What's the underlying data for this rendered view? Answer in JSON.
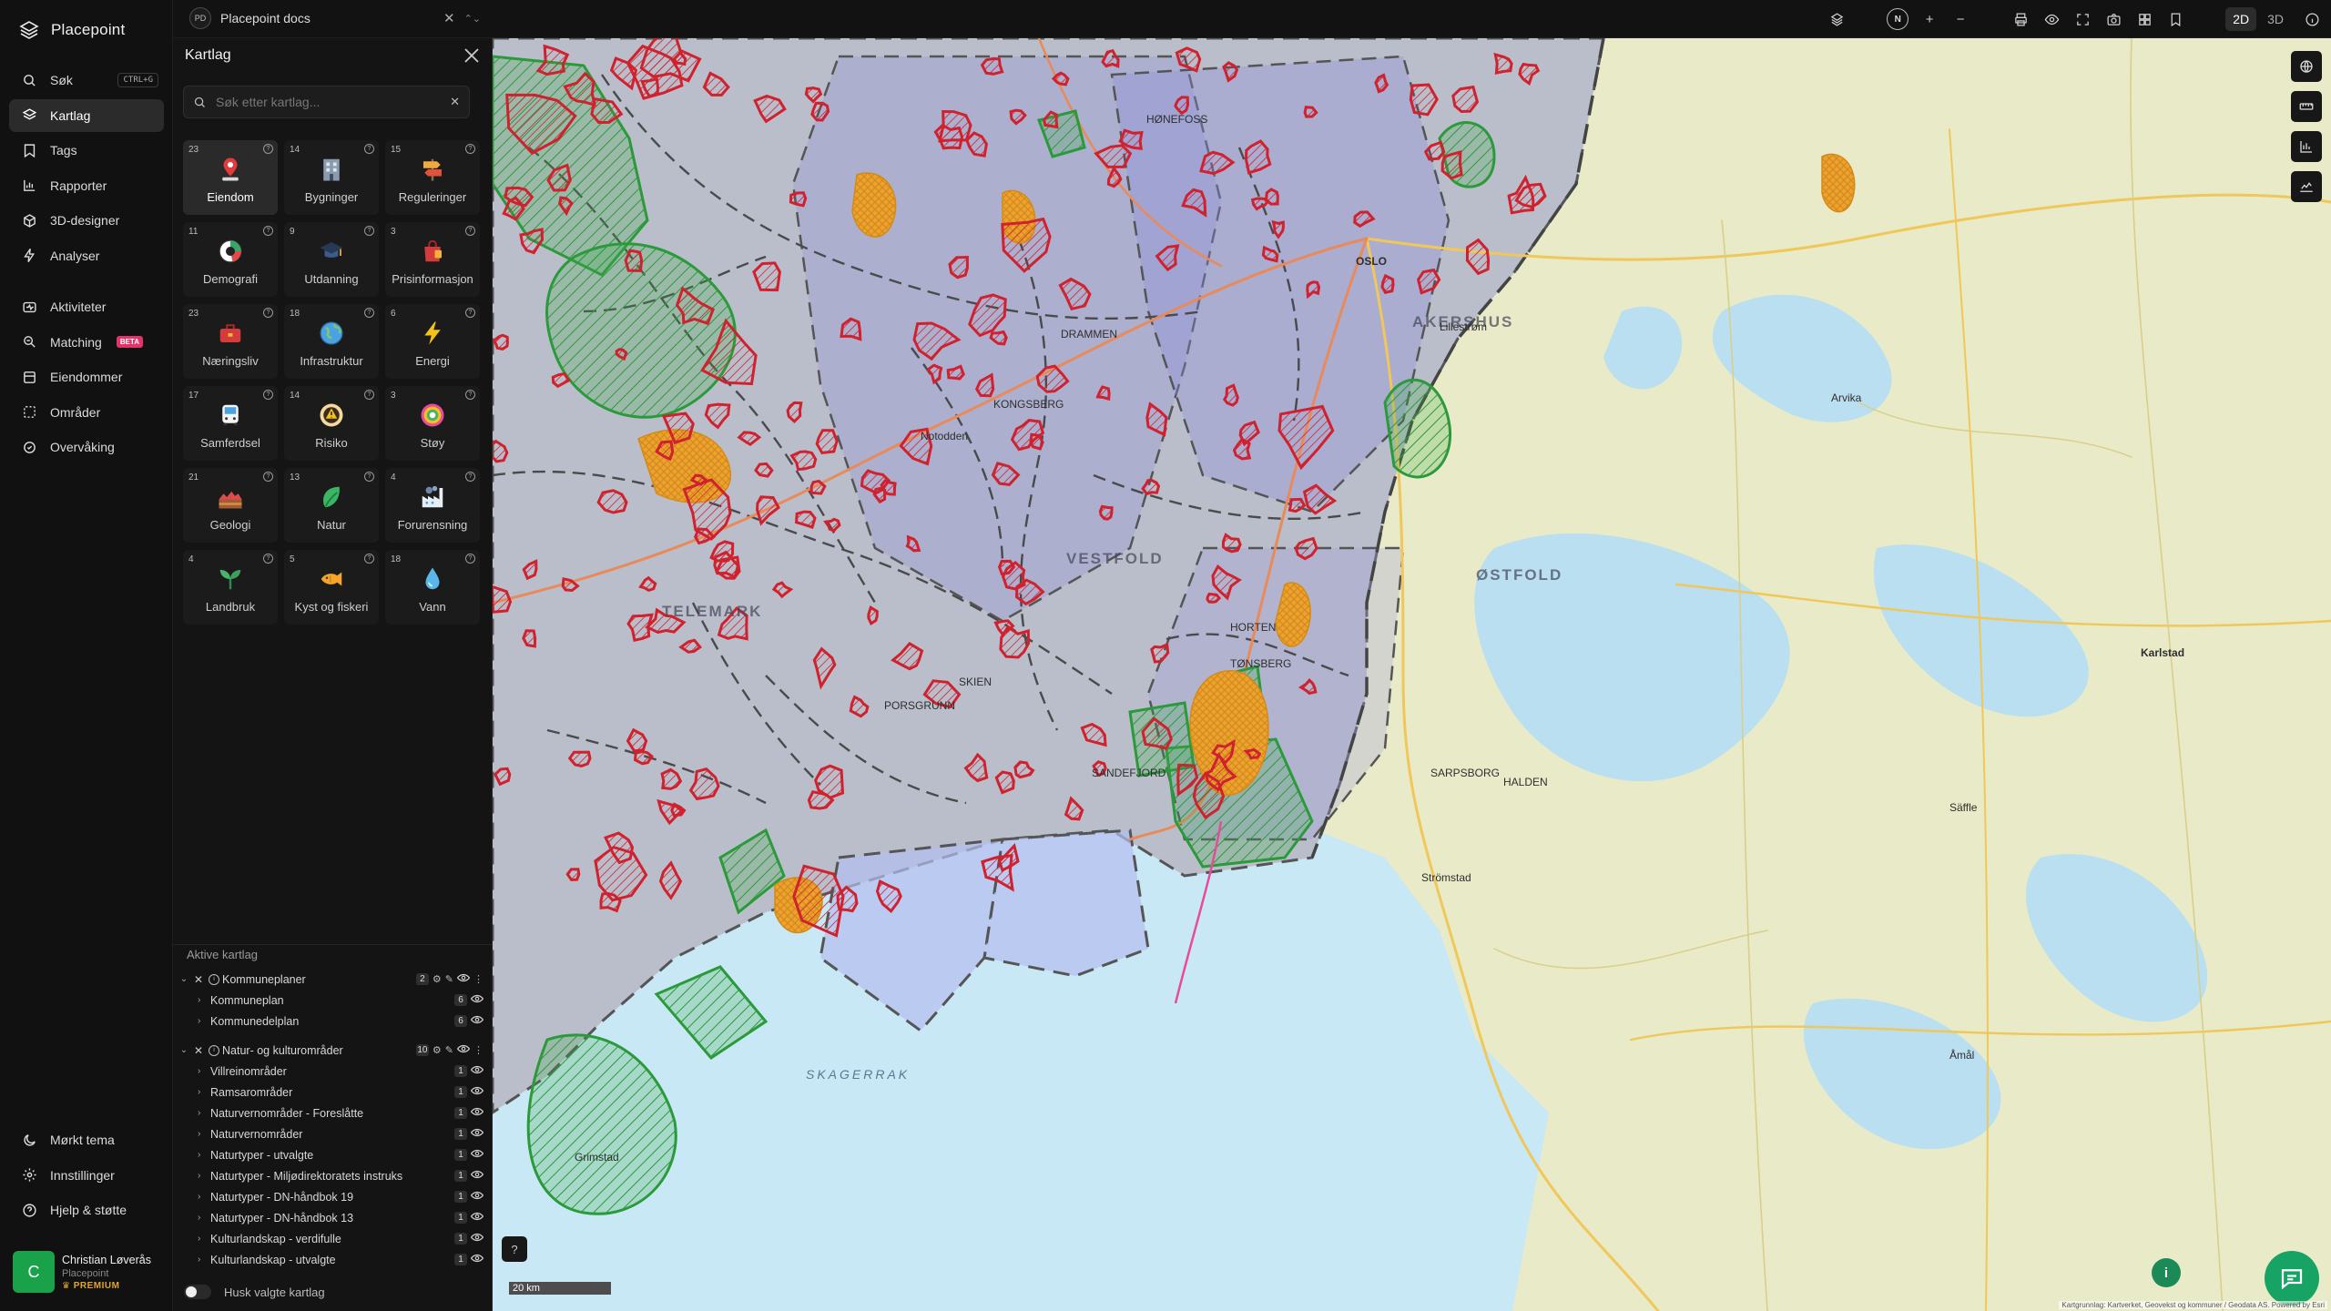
{
  "app": {
    "name": "Placepoint"
  },
  "nav": {
    "items": [
      {
        "label": "Søk",
        "icon": "search-icon",
        "shortcut": "CTRL+G"
      },
      {
        "label": "Kartlag",
        "icon": "layers-icon",
        "active": true
      },
      {
        "label": "Tags",
        "icon": "tag-icon"
      },
      {
        "label": "Rapporter",
        "icon": "chart-icon"
      },
      {
        "label": "3D-designer",
        "icon": "cube-icon"
      },
      {
        "label": "Analyser",
        "icon": "bolt-icon"
      }
    ],
    "items2": [
      {
        "label": "Aktiviteter",
        "icon": "activity-icon"
      },
      {
        "label": "Matching",
        "icon": "match-icon",
        "badge": "BETA"
      },
      {
        "label": "Eiendommer",
        "icon": "building-icon"
      },
      {
        "label": "Områder",
        "icon": "area-icon"
      },
      {
        "label": "Overvåking",
        "icon": "monitor-icon"
      }
    ],
    "bottom": [
      {
        "label": "Mørkt tema",
        "icon": "moon-icon"
      },
      {
        "label": "Innstillinger",
        "icon": "gear-icon"
      },
      {
        "label": "Hjelp & støtte",
        "icon": "help-icon"
      }
    ],
    "user": {
      "initial": "C",
      "name": "Christian Løverås",
      "company": "Placepoint",
      "tier": "PREMIUM"
    }
  },
  "topbar": {
    "doc_badge": "PD",
    "doc_title": "Placepoint docs",
    "north": "N",
    "view_2d": "2D",
    "view_3d": "3D"
  },
  "panel": {
    "title": "Kartlag",
    "search_placeholder": "Søk etter kartlag...",
    "tiles": [
      {
        "count": "23",
        "label": "Eiendom",
        "icon": "pin-icon",
        "active": true
      },
      {
        "count": "14",
        "label": "Bygninger",
        "icon": "building-icon"
      },
      {
        "count": "15",
        "label": "Reguleringer",
        "icon": "signpost-icon"
      },
      {
        "count": "11",
        "label": "Demografi",
        "icon": "demography-icon"
      },
      {
        "count": "9",
        "label": "Utdanning",
        "icon": "graduation-icon"
      },
      {
        "count": "3",
        "label": "Prisinformasjon",
        "icon": "shopping-bag-icon"
      },
      {
        "count": "23",
        "label": "Næringsliv",
        "icon": "briefcase-icon"
      },
      {
        "count": "18",
        "label": "Infrastruktur",
        "icon": "globe-icon"
      },
      {
        "count": "6",
        "label": "Energi",
        "icon": "lightning-icon"
      },
      {
        "count": "17",
        "label": "Samferdsel",
        "icon": "bus-icon"
      },
      {
        "count": "14",
        "label": "Risiko",
        "icon": "warning-icon"
      },
      {
        "count": "3",
        "label": "Støy",
        "icon": "noise-icon"
      },
      {
        "count": "21",
        "label": "Geologi",
        "icon": "geology-icon"
      },
      {
        "count": "13",
        "label": "Natur",
        "icon": "leaf-icon"
      },
      {
        "count": "4",
        "label": "Forurensning",
        "icon": "factory-icon"
      },
      {
        "count": "4",
        "label": "Landbruk",
        "icon": "sprout-icon"
      },
      {
        "count": "5",
        "label": "Kyst og fiskeri",
        "icon": "fish-icon"
      },
      {
        "count": "18",
        "label": "Vann",
        "icon": "water-drop-icon"
      }
    ],
    "active_header": "Aktive kartlag",
    "groups": [
      {
        "name": "Kommuneplaner",
        "count": "2",
        "children": [
          {
            "name": "Kommuneplan",
            "count": "6"
          },
          {
            "name": "Kommunedelplan",
            "count": "6"
          }
        ]
      },
      {
        "name": "Natur- og kulturområder",
        "count": "10",
        "children": [
          {
            "name": "Villreinområder",
            "count": "1"
          },
          {
            "name": "Ramsarområder",
            "count": "1"
          },
          {
            "name": "Naturvernområder - Foreslåtte",
            "count": "1"
          },
          {
            "name": "Naturvernområder",
            "count": "1"
          },
          {
            "name": "Naturtyper - utvalgte",
            "count": "1"
          },
          {
            "name": "Naturtyper - Miljødirektoratets instruks",
            "count": "1"
          },
          {
            "name": "Naturtyper - DN-håndbok 19",
            "count": "1"
          },
          {
            "name": "Naturtyper - DN-håndbok 13",
            "count": "1"
          },
          {
            "name": "Kulturlandskap - verdifulle",
            "count": "1"
          },
          {
            "name": "Kulturlandskap - utvalgte",
            "count": "1"
          }
        ]
      }
    ],
    "remember_label": "Husk valgte kartlag"
  },
  "map": {
    "regions": [
      "VESTFOLD",
      "AKERSHUS",
      "ØSTFOLD",
      "TELEMARK"
    ],
    "sea": "SKAGERRAK",
    "cities": [
      "OSLO",
      "HØNEFOSS",
      "DRAMMEN",
      "KONGSBERG",
      "HORTEN",
      "TØNSBERG",
      "SANDEFJORD",
      "SKIEN",
      "PORSGRUNN",
      "SARPSBORG",
      "HALDEN",
      "Strömstad",
      "Grimstad",
      "Notodden",
      "Lillestrøm",
      "Karlstad",
      "Arvika",
      "Säffle",
      "Åmål"
    ],
    "scale_label": "20 km",
    "attribution": "Kartgrunnlag: Kartverket, Geovekst og kommuner / Geodata AS. Powered by Esri",
    "colors": {
      "land_se": "#e7e9c6",
      "land_no": "#c8d6b4",
      "water": "#c9e8f5",
      "plan_fill": "#a9a8d3",
      "red_zone": "#d0212e",
      "green_zone": "#2b9a3a",
      "orange_zone": "#f0a12b"
    }
  }
}
